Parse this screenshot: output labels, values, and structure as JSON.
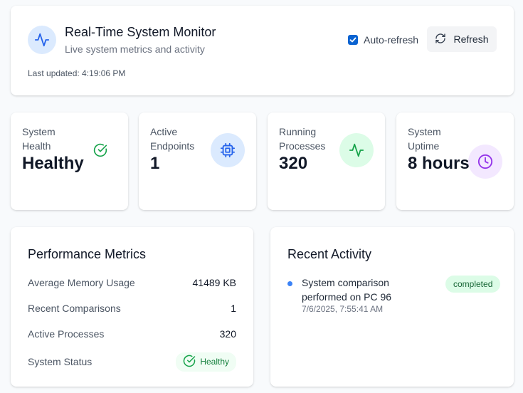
{
  "header": {
    "title": "Real-Time System Monitor",
    "subtitle": "Live system metrics and activity",
    "last_updated": "Last updated: 4:19:06 PM",
    "auto_refresh_label": "Auto-refresh",
    "auto_refresh_checked": true,
    "refresh_label": "Refresh",
    "icon": "activity-icon"
  },
  "stats": [
    {
      "label": "System Health",
      "value": "Healthy",
      "icon": "check-circle-icon",
      "color": "#16a34a"
    },
    {
      "label": "Active Endpoints",
      "value": "1",
      "icon": "cpu-icon",
      "color": "#2563eb",
      "bg": "#dbeafe"
    },
    {
      "label": "Running Processes",
      "value": "320",
      "icon": "activity-icon",
      "color": "#16a34a",
      "bg": "#dcfce7"
    },
    {
      "label": "System Uptime",
      "value": "8 hours",
      "icon": "clock-icon",
      "color": "#9333ea",
      "bg": "#f3e8ff"
    }
  ],
  "performance": {
    "title": "Performance Metrics",
    "rows": [
      {
        "label": "Average Memory Usage",
        "value": "41489 KB"
      },
      {
        "label": "Recent Comparisons",
        "value": "1"
      },
      {
        "label": "Active Processes",
        "value": "320"
      },
      {
        "label": "System Status",
        "value": "Healthy"
      }
    ]
  },
  "activity": {
    "title": "Recent Activity",
    "items": [
      {
        "text": "System comparison performed on PC 96",
        "time": "7/6/2025, 7:55:41 AM",
        "status": "completed"
      }
    ]
  }
}
